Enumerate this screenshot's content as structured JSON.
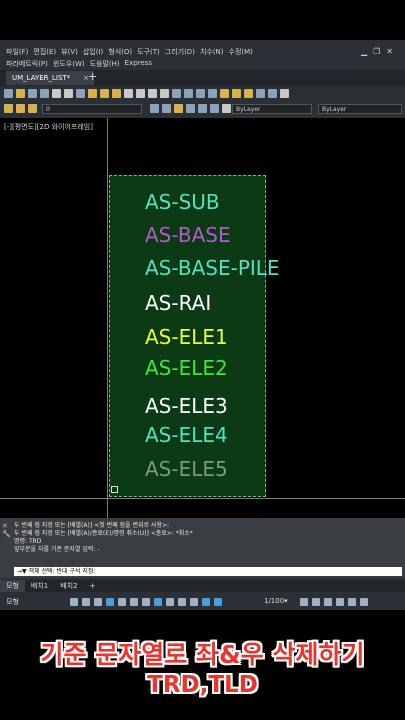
{
  "menu": {
    "row1": [
      "파일(F)",
      "편집(E)",
      "뷰(V)",
      "삽입(I)",
      "형식(O)",
      "도구(T)",
      "그리기(D)",
      "치수(N)",
      "수정(M)"
    ],
    "row2": [
      "파라메트릭(P)",
      "윈도우(W)",
      "도움말(H)",
      "Express"
    ]
  },
  "document_tab": {
    "label": "UM_LAYER_LIST*",
    "close": "×",
    "new": "+"
  },
  "toolbar": {
    "layer_value": "0",
    "color_value": "ByLayer",
    "linetype_value": "ByLayer"
  },
  "viewport": {
    "label": "[-][평면도][2D 와이어프레임]"
  },
  "layers": [
    {
      "name": "AS-SUB",
      "color": "#56e1c0"
    },
    {
      "name": "AS-BASE",
      "color": "#b25ccb"
    },
    {
      "name": "AS-BASE-PILE",
      "color": "#56e1c0"
    },
    {
      "name": "AS-RAI",
      "color": "#ffffff"
    },
    {
      "name": "AS-ELE1",
      "color": "#e6ff3a"
    },
    {
      "name": "AS-ELE2",
      "color": "#3ee63e"
    },
    {
      "name": "AS-ELE3",
      "color": "#ffffff"
    },
    {
      "name": "AS-ELE4",
      "color": "#56e1c0"
    },
    {
      "name": "AS-ELE5",
      "color": "#7a9a7a"
    }
  ],
  "command": {
    "line1": "두 번째 점 지정 또는 [배열(A)] <첫 번째 점을 변위로 사용>:",
    "line2": "두 번째 점 지정 또는 [배열(A)/종료(E)/명령 취소(U)] <종료>: *취소*",
    "line3": "명령: TRD",
    "line4": "앞부분을 자를 기준 문자열 입력: -",
    "input": "→▼ 객체 선택: 반대 구석 지정:"
  },
  "layout_tabs": [
    "모형",
    "배치1",
    "배치2",
    "+"
  ],
  "status": {
    "model": "모형",
    "scale": "1/100▾"
  },
  "caption": {
    "line1": "기준 문자열로 좌&우 삭제하기",
    "line2": "TRD,TLD"
  }
}
